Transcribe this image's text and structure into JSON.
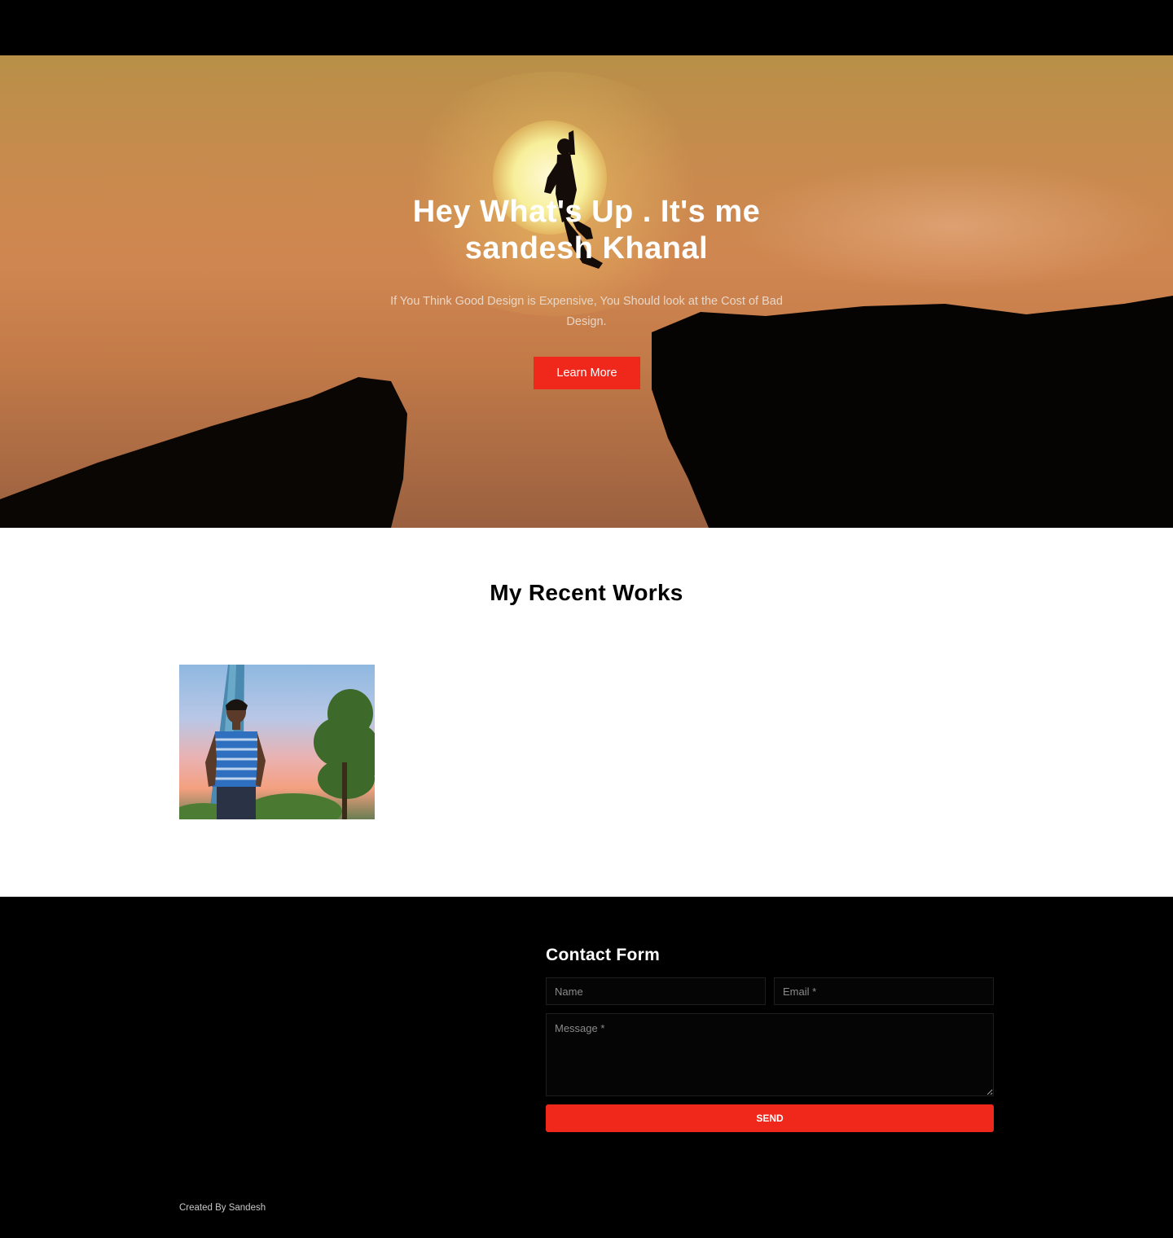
{
  "hero": {
    "title_line1": "Hey What's Up . It's me",
    "title_line2": "sandesh Khanal",
    "subtitle_line1": "If You Think Good Design is Expensive, You Should look at the Cost of Bad",
    "subtitle_line2": "Design.",
    "cta_label": "Learn More"
  },
  "works": {
    "title": "My Recent Works"
  },
  "contact": {
    "title": "Contact Form",
    "name_placeholder": "Name",
    "email_placeholder": "Email *",
    "message_placeholder": "Message *",
    "send_label": "SEND"
  },
  "footer": {
    "credit": "Created By Sandesh"
  },
  "colors": {
    "accent": "#f0271b",
    "background": "#000000",
    "section_bg": "#ffffff"
  }
}
